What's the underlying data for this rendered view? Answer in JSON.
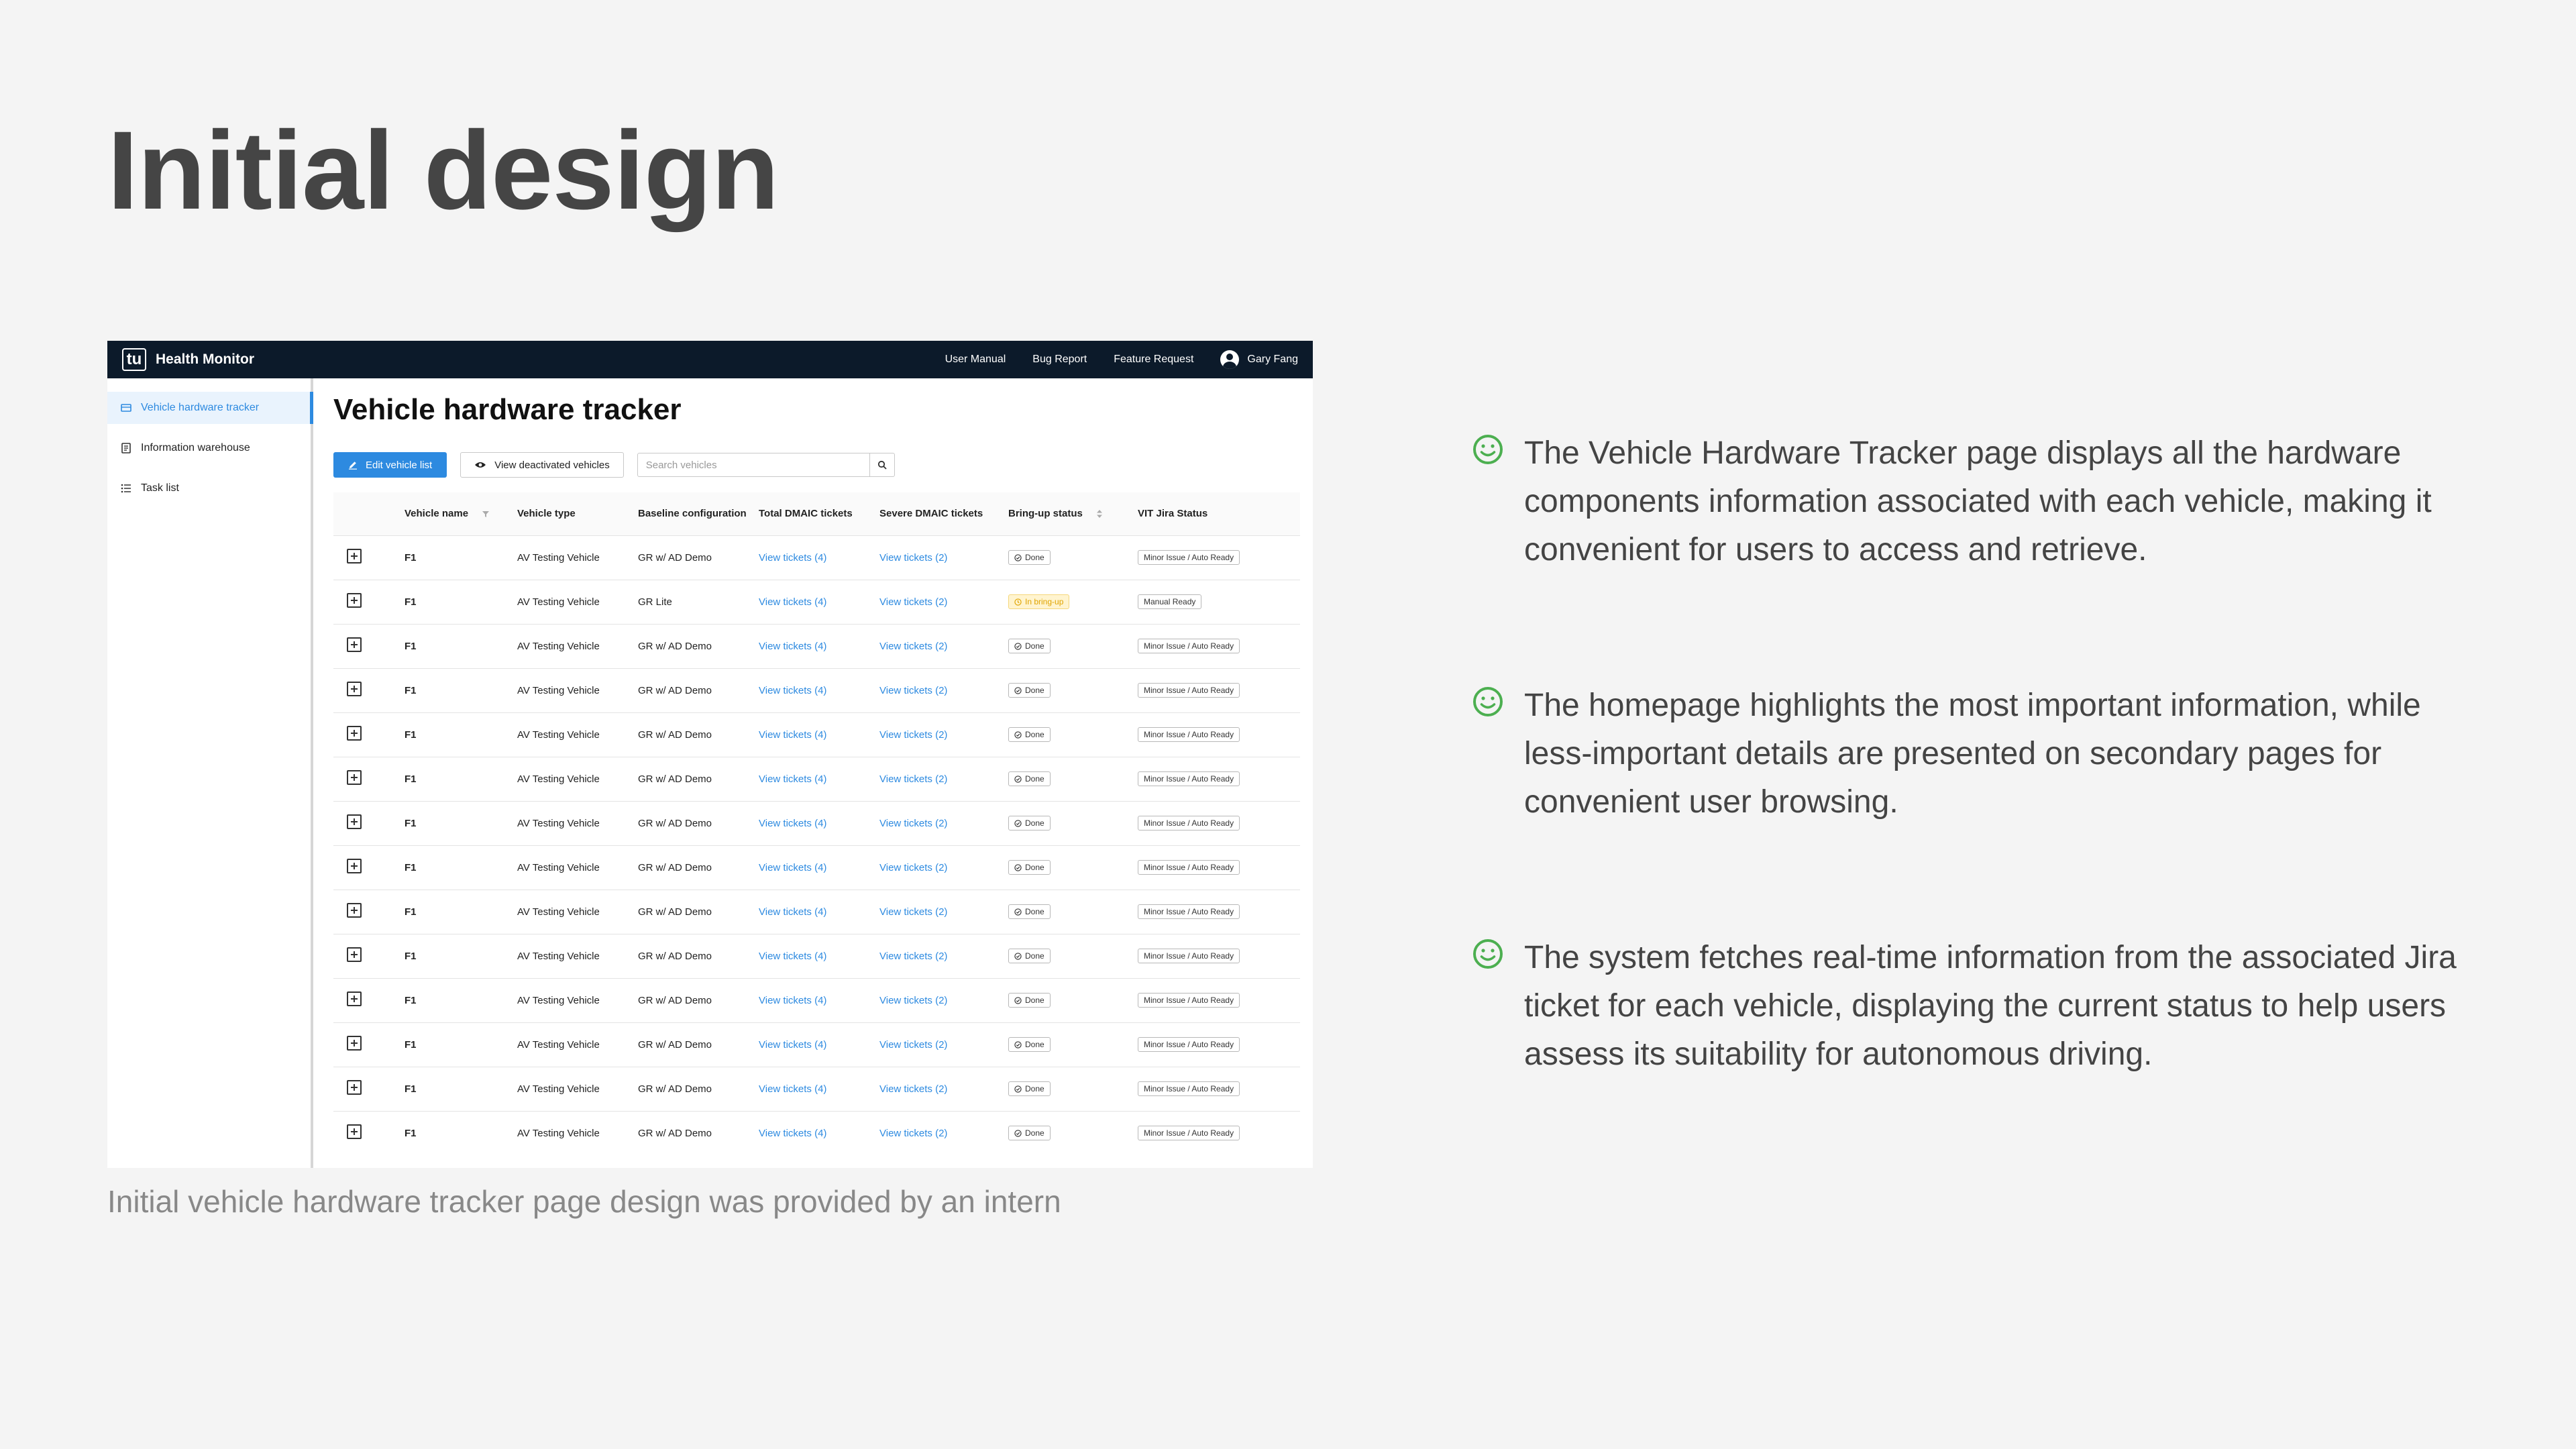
{
  "slide": {
    "title": "Initial design",
    "caption": "Initial vehicle hardware tracker page design was provided by an intern",
    "notes": [
      "The Vehicle Hardware Tracker page displays all the hardware components information associated with each vehicle, making it convenient for users to access and retrieve.",
      "The homepage highlights the most important information, while less-important details are presented on secondary pages for convenient user browsing.",
      "The system fetches real-time information from the associated Jira ticket for each vehicle, displaying the current status to help users assess its suitability for autonomous driving."
    ],
    "note_icon": "smile-icon",
    "colors": {
      "background": "#f4f4f4",
      "note_icon": "#4caf50",
      "title": "#454545"
    }
  },
  "app": {
    "logo": "tu",
    "name": "Health Monitor",
    "top_links": [
      "User Manual",
      "Bug Report",
      "Feature Request"
    ],
    "user": "Gary Fang",
    "sidebar": [
      {
        "label": "Vehicle hardware tracker",
        "icon": "tracker-icon",
        "active": true
      },
      {
        "label": "Information warehouse",
        "icon": "document-icon",
        "active": false
      },
      {
        "label": "Task list",
        "icon": "list-icon",
        "active": false
      }
    ],
    "page_title": "Vehicle hardware tracker",
    "toolbar": {
      "edit_label": "Edit vehicle list",
      "view_deactivated_label": "View deactivated vehicles",
      "search_placeholder": "Search vehicles"
    },
    "colors": {
      "topbar": "#0c1a2a",
      "accent": "#2d8ae0",
      "warn": "#e0a400"
    },
    "table": {
      "columns": [
        "Vehicle name",
        "Vehicle type",
        "Baseline configuration",
        "Total DMAIC tickets",
        "Severe DMAIC tickets",
        "Bring-up status",
        "VIT Jira Status"
      ],
      "rows": [
        {
          "name": "F1",
          "type": "AV Testing Vehicle",
          "config": "GR w/ AD Demo",
          "total": "View tickets (4)",
          "severe": "View tickets (2)",
          "bringup": "Done",
          "jira": "Minor Issue / Auto Ready"
        },
        {
          "name": "F1",
          "type": "AV Testing Vehicle",
          "config": "GR Lite",
          "total": "View tickets (4)",
          "severe": "View tickets (2)",
          "bringup": "In bring-up",
          "jira": "Manual Ready"
        },
        {
          "name": "F1",
          "type": "AV Testing Vehicle",
          "config": "GR w/ AD Demo",
          "total": "View tickets (4)",
          "severe": "View tickets (2)",
          "bringup": "Done",
          "jira": "Minor Issue / Auto Ready"
        },
        {
          "name": "F1",
          "type": "AV Testing Vehicle",
          "config": "GR w/ AD Demo",
          "total": "View tickets (4)",
          "severe": "View tickets (2)",
          "bringup": "Done",
          "jira": "Minor Issue / Auto Ready"
        },
        {
          "name": "F1",
          "type": "AV Testing Vehicle",
          "config": "GR w/ AD Demo",
          "total": "View tickets (4)",
          "severe": "View tickets (2)",
          "bringup": "Done",
          "jira": "Minor Issue / Auto Ready"
        },
        {
          "name": "F1",
          "type": "AV Testing Vehicle",
          "config": "GR w/ AD Demo",
          "total": "View tickets (4)",
          "severe": "View tickets (2)",
          "bringup": "Done",
          "jira": "Minor Issue / Auto Ready"
        },
        {
          "name": "F1",
          "type": "AV Testing Vehicle",
          "config": "GR w/ AD Demo",
          "total": "View tickets (4)",
          "severe": "View tickets (2)",
          "bringup": "Done",
          "jira": "Minor Issue / Auto Ready"
        },
        {
          "name": "F1",
          "type": "AV Testing Vehicle",
          "config": "GR w/ AD Demo",
          "total": "View tickets (4)",
          "severe": "View tickets (2)",
          "bringup": "Done",
          "jira": "Minor Issue / Auto Ready"
        },
        {
          "name": "F1",
          "type": "AV Testing Vehicle",
          "config": "GR w/ AD Demo",
          "total": "View tickets (4)",
          "severe": "View tickets (2)",
          "bringup": "Done",
          "jira": "Minor Issue / Auto Ready"
        },
        {
          "name": "F1",
          "type": "AV Testing Vehicle",
          "config": "GR w/ AD Demo",
          "total": "View tickets (4)",
          "severe": "View tickets (2)",
          "bringup": "Done",
          "jira": "Minor Issue / Auto Ready"
        },
        {
          "name": "F1",
          "type": "AV Testing Vehicle",
          "config": "GR w/ AD Demo",
          "total": "View tickets (4)",
          "severe": "View tickets (2)",
          "bringup": "Done",
          "jira": "Minor Issue / Auto Ready"
        },
        {
          "name": "F1",
          "type": "AV Testing Vehicle",
          "config": "GR w/ AD Demo",
          "total": "View tickets (4)",
          "severe": "View tickets (2)",
          "bringup": "Done",
          "jira": "Minor Issue / Auto Ready"
        },
        {
          "name": "F1",
          "type": "AV Testing Vehicle",
          "config": "GR w/ AD Demo",
          "total": "View tickets (4)",
          "severe": "View tickets (2)",
          "bringup": "Done",
          "jira": "Minor Issue / Auto Ready"
        },
        {
          "name": "F1",
          "type": "AV Testing Vehicle",
          "config": "GR w/ AD Demo",
          "total": "View tickets (4)",
          "severe": "View tickets (2)",
          "bringup": "Done",
          "jira": "Minor Issue / Auto Ready"
        }
      ]
    }
  }
}
